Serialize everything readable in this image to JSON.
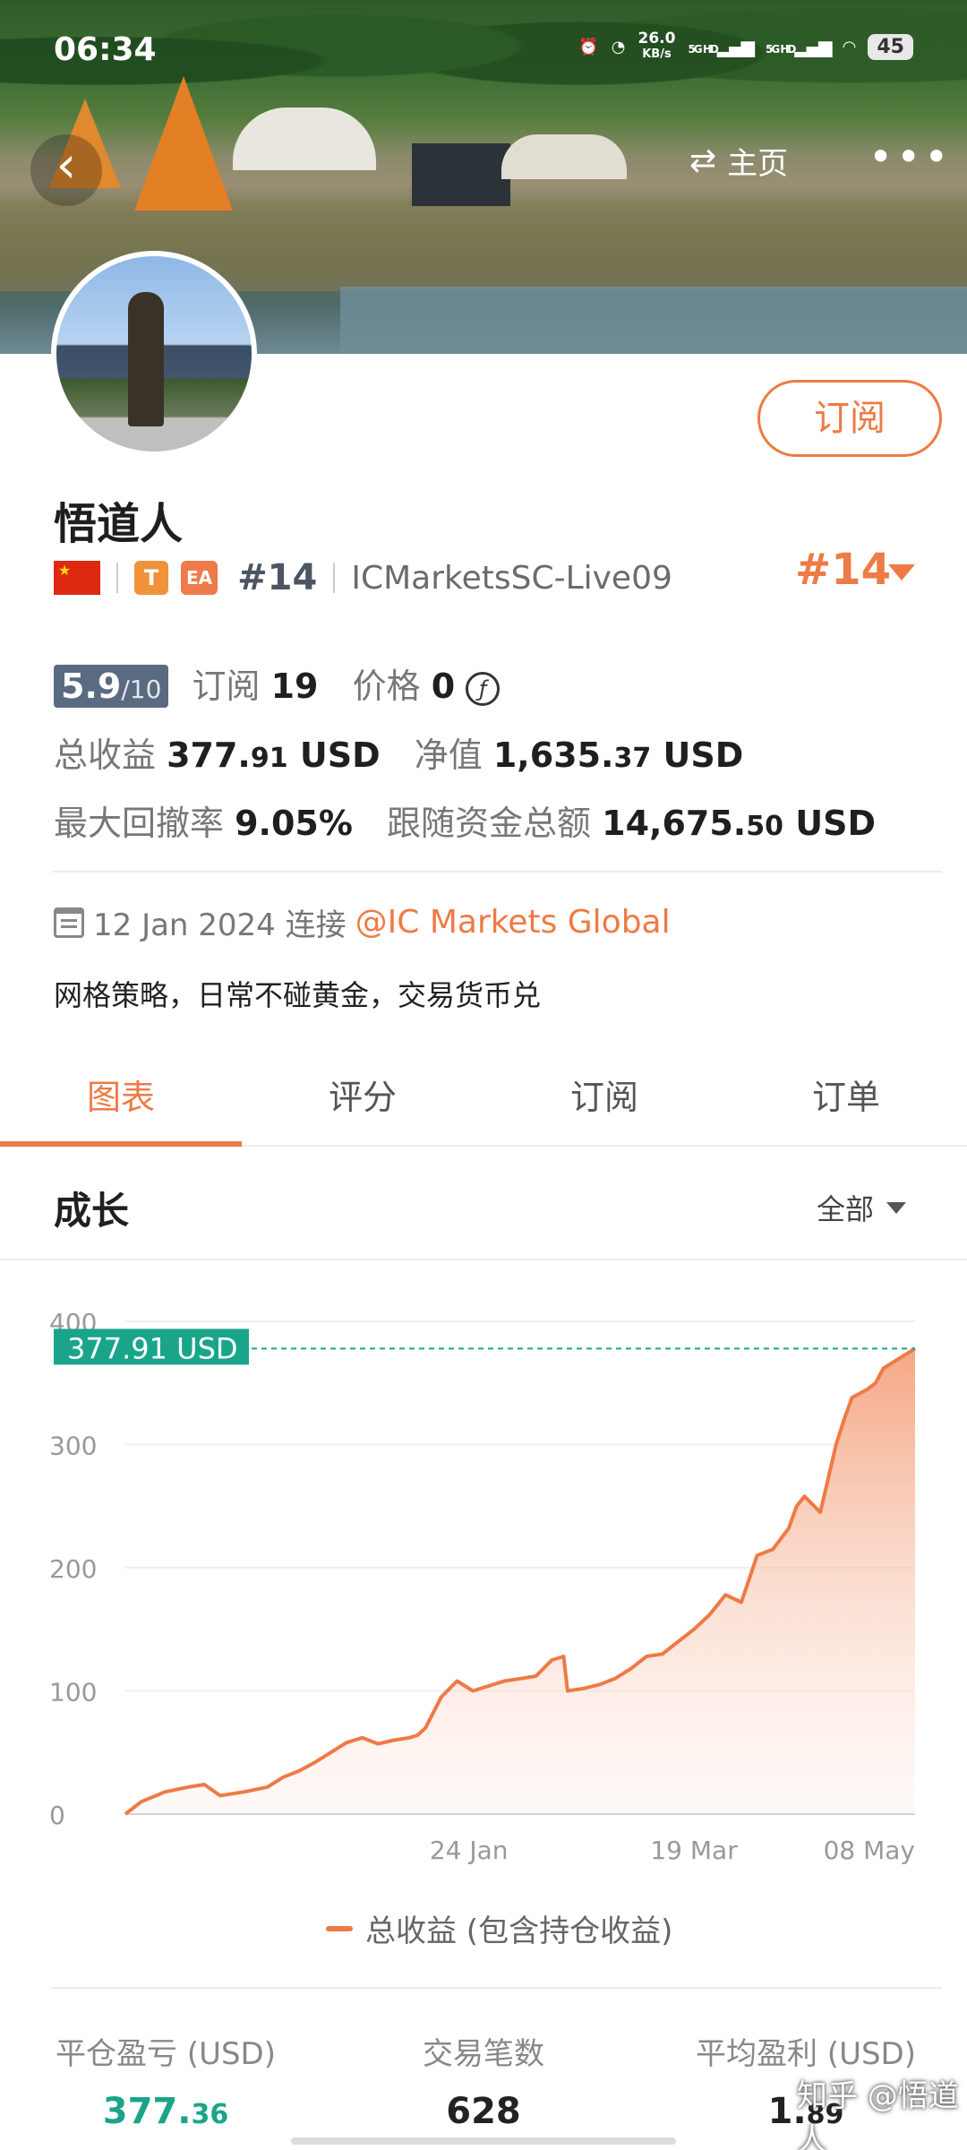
{
  "status_bar": {
    "time": "06:34",
    "network_speed": "26.0",
    "network_unit": "KB/s",
    "sim1": "5G HD",
    "sim2": "5G HD",
    "battery": "45"
  },
  "header": {
    "home_label": "主页",
    "back_icon": "chevron-left-icon",
    "more_icon": "more-dots-icon",
    "switch_icon": "swap-icon"
  },
  "profile": {
    "name": "悟道人",
    "subscribe_label": "订阅",
    "badge_t": "T",
    "badge_ea": "EA",
    "rank_small": "#14",
    "account": "ICMarketsSC-Live09",
    "rank_big": "#14",
    "score": "5.9",
    "score_max": "/10",
    "subs_label": "订阅",
    "subs_value": "19",
    "price_label": "价格",
    "price_value": "0",
    "price_icon": "ƒ",
    "total_profit_label": "总收益",
    "total_profit_main": "377.",
    "total_profit_dec": "91",
    "total_profit_unit": "USD",
    "net_label": "净值",
    "net_main": "1,635.",
    "net_dec": "37",
    "net_unit": "USD",
    "drawdown_label": "最大回撤率",
    "drawdown_value": "9.05%",
    "follow_label": "跟随资金总额",
    "follow_main": "14,675.",
    "follow_dec": "50",
    "follow_unit": "USD",
    "connect_date": "12 Jan 2024 连接",
    "broker": "@IC Markets Global",
    "description": "网格策略，日常不碰黄金，交易货币兑"
  },
  "tabs": [
    "图表",
    "评分",
    "订阅",
    "订单"
  ],
  "growth": {
    "title": "成长",
    "range": "全部"
  },
  "chart_data": {
    "type": "area",
    "ylim": [
      0,
      400
    ],
    "y_ticks": [
      "0",
      "100",
      "200",
      "300",
      "400"
    ],
    "x_ticks": [
      "24 Jan",
      "19 Mar",
      "08 May"
    ],
    "current_label": "377.91 USD",
    "current_value": 377.91,
    "series": [
      {
        "name": "总收益 (包含持仓收益)",
        "x": [
          0,
          0.02,
          0.05,
          0.08,
          0.1,
          0.12,
          0.15,
          0.18,
          0.2,
          0.22,
          0.24,
          0.26,
          0.28,
          0.3,
          0.32,
          0.34,
          0.36,
          0.37,
          0.38,
          0.4,
          0.42,
          0.44,
          0.46,
          0.48,
          0.5,
          0.52,
          0.54,
          0.555,
          0.56,
          0.58,
          0.6,
          0.62,
          0.64,
          0.66,
          0.68,
          0.7,
          0.72,
          0.74,
          0.76,
          0.78,
          0.8,
          0.82,
          0.84,
          0.85,
          0.86,
          0.88,
          0.9,
          0.91,
          0.92,
          0.94,
          0.95,
          0.96,
          0.98,
          1.0
        ],
        "values": [
          0,
          10,
          18,
          22,
          24,
          15,
          18,
          22,
          30,
          35,
          42,
          50,
          58,
          62,
          57,
          60,
          62,
          64,
          70,
          95,
          108,
          100,
          104,
          108,
          110,
          112,
          125,
          128,
          100,
          102,
          105,
          110,
          118,
          128,
          130,
          140,
          150,
          162,
          178,
          172,
          210,
          215,
          232,
          250,
          258,
          245,
          300,
          320,
          338,
          345,
          350,
          362,
          370,
          378
        ]
      }
    ]
  },
  "stats": {
    "closed_pl_label": "平仓盈亏 (USD)",
    "closed_pl_main": "377.",
    "closed_pl_dec": "36",
    "trades_label": "交易笔数",
    "trades_value": "628",
    "avg_profit_label": "平均盈利 (USD)",
    "avg_profit_main": "1.",
    "avg_profit_dec": "89"
  },
  "watermark": "知乎 @悟道人",
  "colors": {
    "accent": "#ee7a45",
    "green": "#1aa58a",
    "score_bg": "#5a6a80"
  }
}
